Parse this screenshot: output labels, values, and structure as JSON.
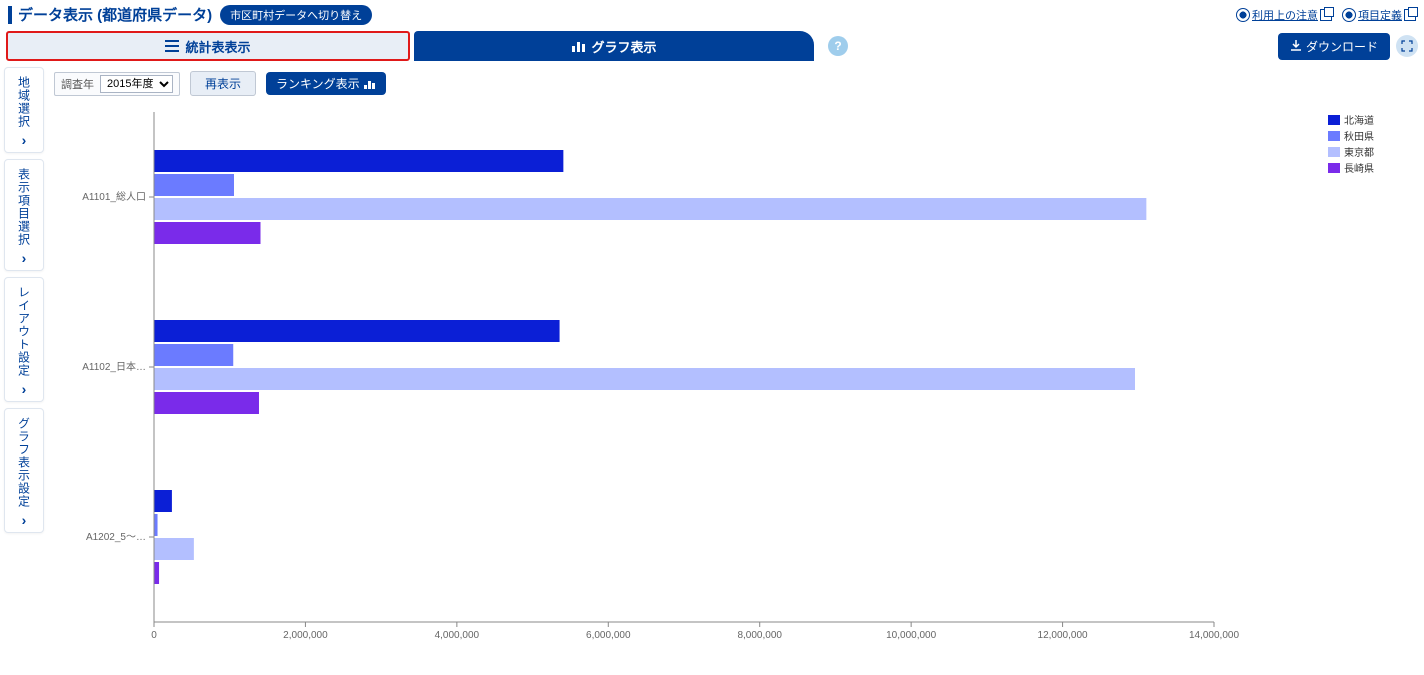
{
  "header": {
    "title": "データ表示 (都道府県データ)",
    "switch_pill": "市区町村データへ切り替え",
    "link_notice": "利用上の注意",
    "link_def": "項目定義"
  },
  "tabs": {
    "table": "統計表表示",
    "graph": "グラフ表示",
    "help": "?",
    "download": "ダウンロード"
  },
  "sidebar": {
    "items": [
      {
        "label": "地域選択"
      },
      {
        "label": "表示項目選択"
      },
      {
        "label": "レイアウト設定"
      },
      {
        "label": "グラフ表示設定"
      }
    ]
  },
  "controls": {
    "year_label": "調査年",
    "year_value": "2015年度",
    "redisplay": "再表示",
    "ranking": "ランキング表示"
  },
  "chart_data": {
    "type": "bar",
    "orientation": "horizontal",
    "xlim": [
      0,
      14000000
    ],
    "x_ticks": [
      0,
      2000000,
      4000000,
      6000000,
      8000000,
      10000000,
      12000000,
      14000000
    ],
    "categories": [
      "A1101_総人口",
      "A1102_日本…",
      "A1202_5～…"
    ],
    "series": [
      {
        "name": "北海道",
        "color": "#0b1fd6",
        "values": [
          5400000,
          5350000,
          230000
        ]
      },
      {
        "name": "秋田県",
        "color": "#6b7bff",
        "values": [
          1050000,
          1040000,
          40000
        ]
      },
      {
        "name": "東京都",
        "color": "#b3bfff",
        "values": [
          13100000,
          12950000,
          520000
        ]
      },
      {
        "name": "長崎県",
        "color": "#7a2bea",
        "values": [
          1400000,
          1380000,
          60000
        ]
      }
    ]
  }
}
